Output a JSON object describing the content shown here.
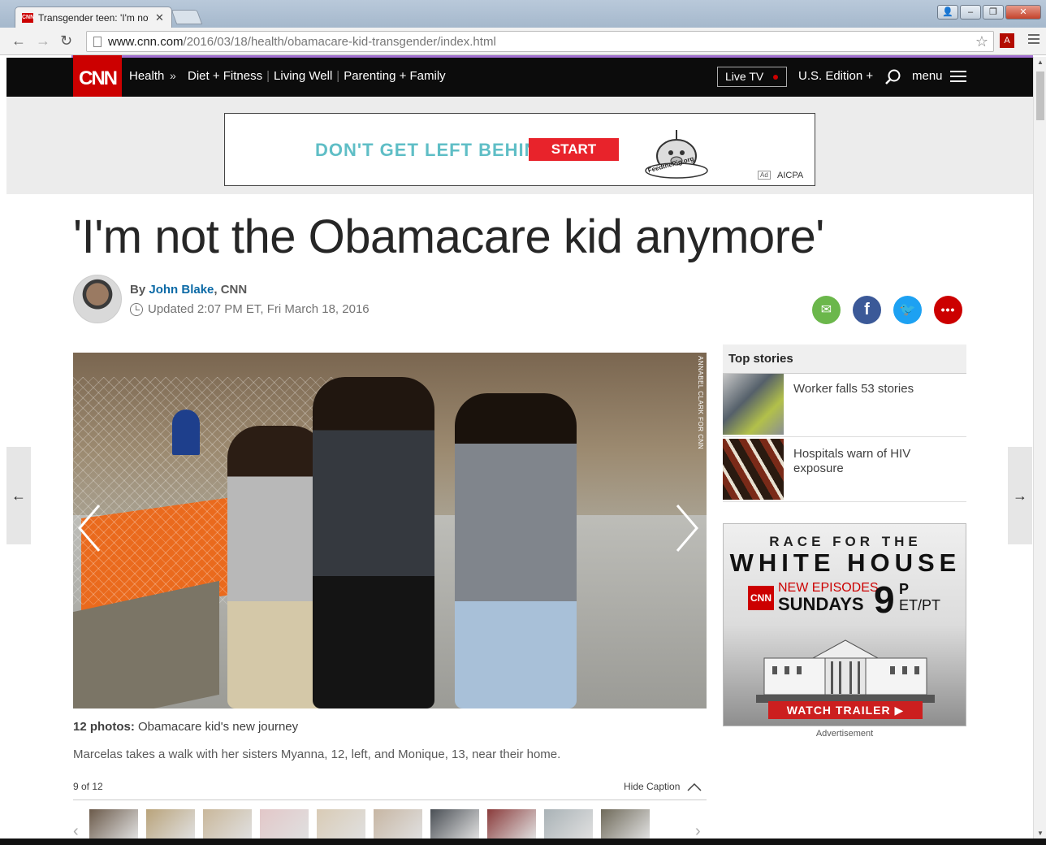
{
  "browser": {
    "tab_title": "Transgender teen: 'I'm not",
    "tab_close": "✕",
    "url_host": "www.cnn.com",
    "url_path": "/2016/03/18/health/obamacare-kid-transgender/index.html",
    "win_min": "‒",
    "win_max": "❐",
    "win_close": "✕"
  },
  "nav": {
    "logo": "CNN",
    "section": "Health",
    "separator": "»",
    "links": [
      "Diet + Fitness",
      "Living Well",
      "Parenting + Family"
    ],
    "live_tv": "Live TV",
    "edition": "U.S. Edition +",
    "menu": "menu"
  },
  "ad_banner": {
    "headline": "DON'T GET LEFT BEHIND.",
    "cta": "START SAVING",
    "mascot_text": "FeedthePig.org",
    "brand": "AICPA"
  },
  "article": {
    "headline": "'I'm not the Obamacare kid anymore'",
    "by_prefix": "By",
    "author": "John Blake",
    "source": ", CNN",
    "updated": "Updated 2:07 PM ET, Fri March 18, 2016"
  },
  "gallery": {
    "photo_credit": "ANNABEL CLARK FOR CNN",
    "count_label": "12 photos:",
    "title": "Obamacare kid's new journey",
    "caption": "Marcelas takes a walk with her sisters Myanna, 12, left, and Monique, 13, near their home.",
    "position": "9 of 12",
    "hide_caption": "Hide Caption",
    "thumbnail_count": 10,
    "thumb_colors": [
      "#6b5a4a",
      "#b9a37a",
      "#c9b79a",
      "#e2c7c8",
      "#d9cbb5",
      "#c7b6a3",
      "#4a4f55",
      "#8a3b3b",
      "#a9b2b6",
      "#6f6a5a"
    ]
  },
  "sidebar": {
    "top_stories_label": "Top stories",
    "stories": [
      {
        "title": "Worker falls 53 stories"
      },
      {
        "title": "Hospitals warn of HIV exposure"
      }
    ],
    "ad": {
      "line1": "RACE FOR THE",
      "line2": "WHITE HOUSE",
      "network": "CNN",
      "new_episodes": "NEW EPISODES",
      "day": "SUNDAYS",
      "time": "9",
      "time_suffix": "P",
      "zone": "ET/PT",
      "cta": "WATCH TRAILER ▶"
    },
    "ad_label": "Advertisement"
  },
  "page_nav": {
    "prev": "←",
    "next": "→"
  },
  "colors": {
    "cnn_red": "#cc0000",
    "nav_black": "#0c0c0c",
    "author_blue": "#0c6aa6"
  }
}
